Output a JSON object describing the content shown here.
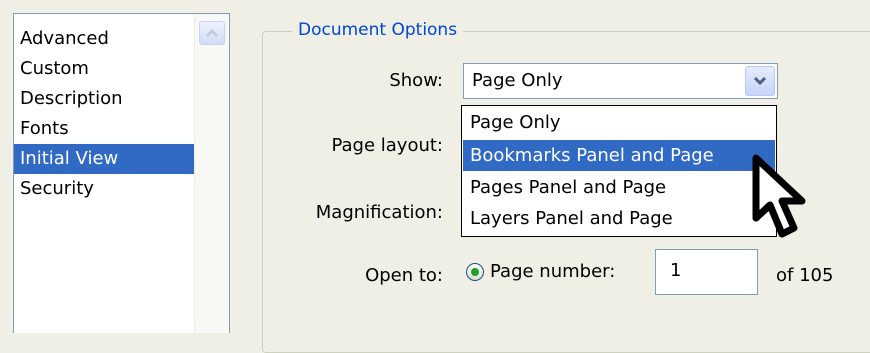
{
  "sidebar": {
    "items": [
      {
        "label": "Advanced"
      },
      {
        "label": "Custom"
      },
      {
        "label": "Description"
      },
      {
        "label": "Fonts"
      },
      {
        "label": "Initial View"
      },
      {
        "label": "Security"
      }
    ],
    "selected": "Initial View"
  },
  "group": {
    "title": "Document Options"
  },
  "labels": {
    "show": "Show:",
    "page_layout": "Page layout:",
    "magnification": "Magnification:",
    "open_to": "Open to:"
  },
  "show_combo": {
    "value": "Page Only",
    "options": [
      {
        "label": "Page Only"
      },
      {
        "label": "Bookmarks Panel and Page"
      },
      {
        "label": "Pages Panel and Page"
      },
      {
        "label": "Layers Panel and Page"
      }
    ],
    "highlighted": "Bookmarks Panel and Page"
  },
  "open_to": {
    "radio_label": "Page number:",
    "page_value": "1",
    "of_text": "of 105"
  },
  "colors": {
    "selection": "#316ac5",
    "group_title": "#0046d5",
    "window_bg": "#f0efe6"
  },
  "icons": {
    "scroll_up": "chevron-up-icon",
    "combo_arrow": "chevron-down-icon",
    "cursor": "mouse-pointer-icon"
  }
}
